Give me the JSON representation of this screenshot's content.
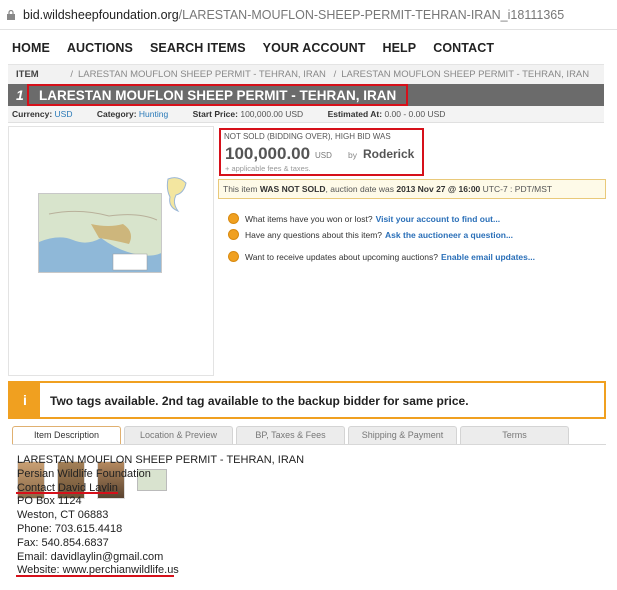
{
  "browser": {
    "url_host": "bid.wildsheepfoundation.org",
    "url_path": "/LARESTAN-MOUFLON-SHEEP-PERMIT-TEHRAN-IRAN_i18111365"
  },
  "nav": [
    "HOME",
    "AUCTIONS",
    "SEARCH ITEMS",
    "YOUR ACCOUNT",
    "HELP",
    "CONTACT"
  ],
  "breadcrumb": {
    "label": "ITEM",
    "items": [
      "LARESTAN MOUFLON SHEEP PERMIT - TEHRAN, IRAN",
      "LARESTAN MOUFLON SHEEP PERMIT - TEHRAN, IRAN"
    ]
  },
  "item": {
    "number": "1",
    "title": "LARESTAN MOUFLON SHEEP PERMIT - TEHRAN, IRAN"
  },
  "meta": {
    "currency_label": "Currency:",
    "currency": "USD",
    "category_label": "Category:",
    "category": "Hunting",
    "start_label": "Start Price:",
    "start_price": "100,000.00 USD",
    "estimated_label": "Estimated At:",
    "estimated": "0.00 - 0.00 USD"
  },
  "bid": {
    "status": "NOT SOLD (BIDDING OVER), HIGH BID WAS",
    "amount": "100,000.00",
    "currency": "USD",
    "by": "by",
    "bidder": "Roderick",
    "fees": "+ applicable fees & taxes."
  },
  "notice": {
    "prefix": "This item",
    "emph": "WAS NOT SOLD",
    "mid": ", auction date was",
    "date": "2013 Nov 27 @ 16:00",
    "tz": "UTC-7 : PDT/MST"
  },
  "help": [
    {
      "text": "What items have you won or lost?",
      "link": "Visit your account to find out..."
    },
    {
      "text": "Have any questions about this item?",
      "link": "Ask the auctioneer a question..."
    },
    {
      "text": "Want to receive updates about upcoming auctions?",
      "link": "Enable email updates..."
    }
  ],
  "tag_notice": {
    "icon": "i",
    "text": "Two tags available. 2nd tag available to the backup bidder for same price."
  },
  "tabs": [
    "Item Description",
    "Location & Preview",
    "BP, Taxes & Fees",
    "Shipping & Payment",
    "Terms"
  ],
  "description": [
    "LARESTAN MOUFLON SHEEP PERMIT - TEHRAN, IRAN",
    "Persian Wildlife Foundation",
    "Contact David Laylin",
    "PO Box 1124",
    "Weston, CT 06883",
    "Phone: 703.615.4418",
    "Fax: 540.854.6837",
    "Email: davidlaylin@gmail.com",
    "Website: www.perchianwildlife.us"
  ],
  "colors": {
    "highlight": "#d6101a",
    "accent": "#f0a020",
    "link": "#2a6fb8"
  }
}
